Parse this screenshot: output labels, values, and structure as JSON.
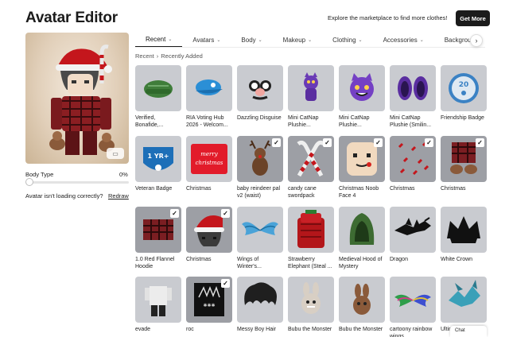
{
  "header": {
    "title": "Avatar Editor",
    "promo_text": "Explore the marketplace to find more clothes!",
    "get_more_label": "Get More"
  },
  "avatar_panel": {
    "body_type_label": "Body Type",
    "body_type_value": "0%",
    "body_type_fraction": 0,
    "loading_text": "Avatar isn't loading correctly?",
    "redraw_label": "Redraw",
    "view_toggle_icon": "3d-toggle-icon"
  },
  "tabs": [
    {
      "label": "Recent",
      "active": true
    },
    {
      "label": "Avatars",
      "active": false
    },
    {
      "label": "Body",
      "active": false
    },
    {
      "label": "Makeup",
      "active": false
    },
    {
      "label": "Clothing",
      "active": false
    },
    {
      "label": "Accessories",
      "active": false
    },
    {
      "label": "Backgrou",
      "active": false
    }
  ],
  "breadcrumb": {
    "root": "Recent",
    "separator": "›",
    "current": "Recently Added"
  },
  "items": [
    {
      "name": "Verified, Bonafide,...",
      "worn": false,
      "icon": "green-cap-icon"
    },
    {
      "name": "RIA Voting Hub 2026 - Welcom...",
      "worn": false,
      "icon": "blue-cap-icon"
    },
    {
      "name": "Dazzling Disguise",
      "worn": false,
      "icon": "disguise-glasses-icon"
    },
    {
      "name": "Mini CatNap Plushie...",
      "worn": false,
      "icon": "purple-cat-plush-icon"
    },
    {
      "name": "Mini CatNap Plushie...",
      "worn": false,
      "icon": "purple-cat-face-icon"
    },
    {
      "name": "Mini CatNap Plushie (Smilin...",
      "worn": false,
      "icon": "purple-ears-icon"
    },
    {
      "name": "Friendship Badge",
      "worn": false,
      "icon": "friendship-badge-icon"
    },
    {
      "name": "Veteran Badge",
      "worn": false,
      "icon": "veteran-badge-icon"
    },
    {
      "name": "Christmas",
      "worn": false,
      "icon": "merry-christmas-icon"
    },
    {
      "name": "baby reindeer pal v2 (waist)",
      "worn": true,
      "icon": "reindeer-icon"
    },
    {
      "name": "candy cane swordpack",
      "worn": true,
      "icon": "candy-cane-icon"
    },
    {
      "name": "Christmas Noob Face 4",
      "worn": true,
      "icon": "noob-face-icon"
    },
    {
      "name": "Christmas",
      "worn": true,
      "icon": "candy-cane-pattern-icon"
    },
    {
      "name": "Christmas",
      "worn": true,
      "icon": "flannel-pants-icon"
    },
    {
      "name": "1.0 Red Flannel Hoodie",
      "worn": true,
      "icon": "flannel-hoodie-icon"
    },
    {
      "name": "Christmas",
      "worn": true,
      "icon": "santa-hat-hair-icon"
    },
    {
      "name": "Wings of Winter's...",
      "worn": false,
      "icon": "blue-wings-icon"
    },
    {
      "name": "Strawberry Elephant (Steal ...",
      "worn": false,
      "icon": "strawberry-elephant-icon"
    },
    {
      "name": "Medieval Hood of Mystery",
      "worn": false,
      "icon": "green-hood-icon"
    },
    {
      "name": "Dragon",
      "worn": false,
      "icon": "dragon-icon"
    },
    {
      "name": "White Crown",
      "worn": false,
      "icon": "crown-icon"
    },
    {
      "name": "evade",
      "worn": false,
      "icon": "shirt-icon"
    },
    {
      "name": "roc",
      "worn": true,
      "icon": "black-shirt-icon"
    },
    {
      "name": "Messy Boy Hair",
      "worn": false,
      "icon": "messy-hair-icon"
    },
    {
      "name": "Bubu the Monster",
      "worn": false,
      "icon": "bubu-plush-icon"
    },
    {
      "name": "Bubu the Monster",
      "worn": false,
      "icon": "bubu-brown-icon"
    },
    {
      "name": "cartoony rainbow wings",
      "worn": false,
      "icon": "rainbow-wings-icon"
    },
    {
      "name": "Ultim Fox",
      "worn": false,
      "icon": "fox-icon"
    }
  ],
  "chat": {
    "label": "Chat"
  },
  "colors": {
    "tile_bg": "#c9cbd0",
    "tile_worn_bg": "#9d9fa5",
    "primary_button": "#1b1b1b"
  }
}
